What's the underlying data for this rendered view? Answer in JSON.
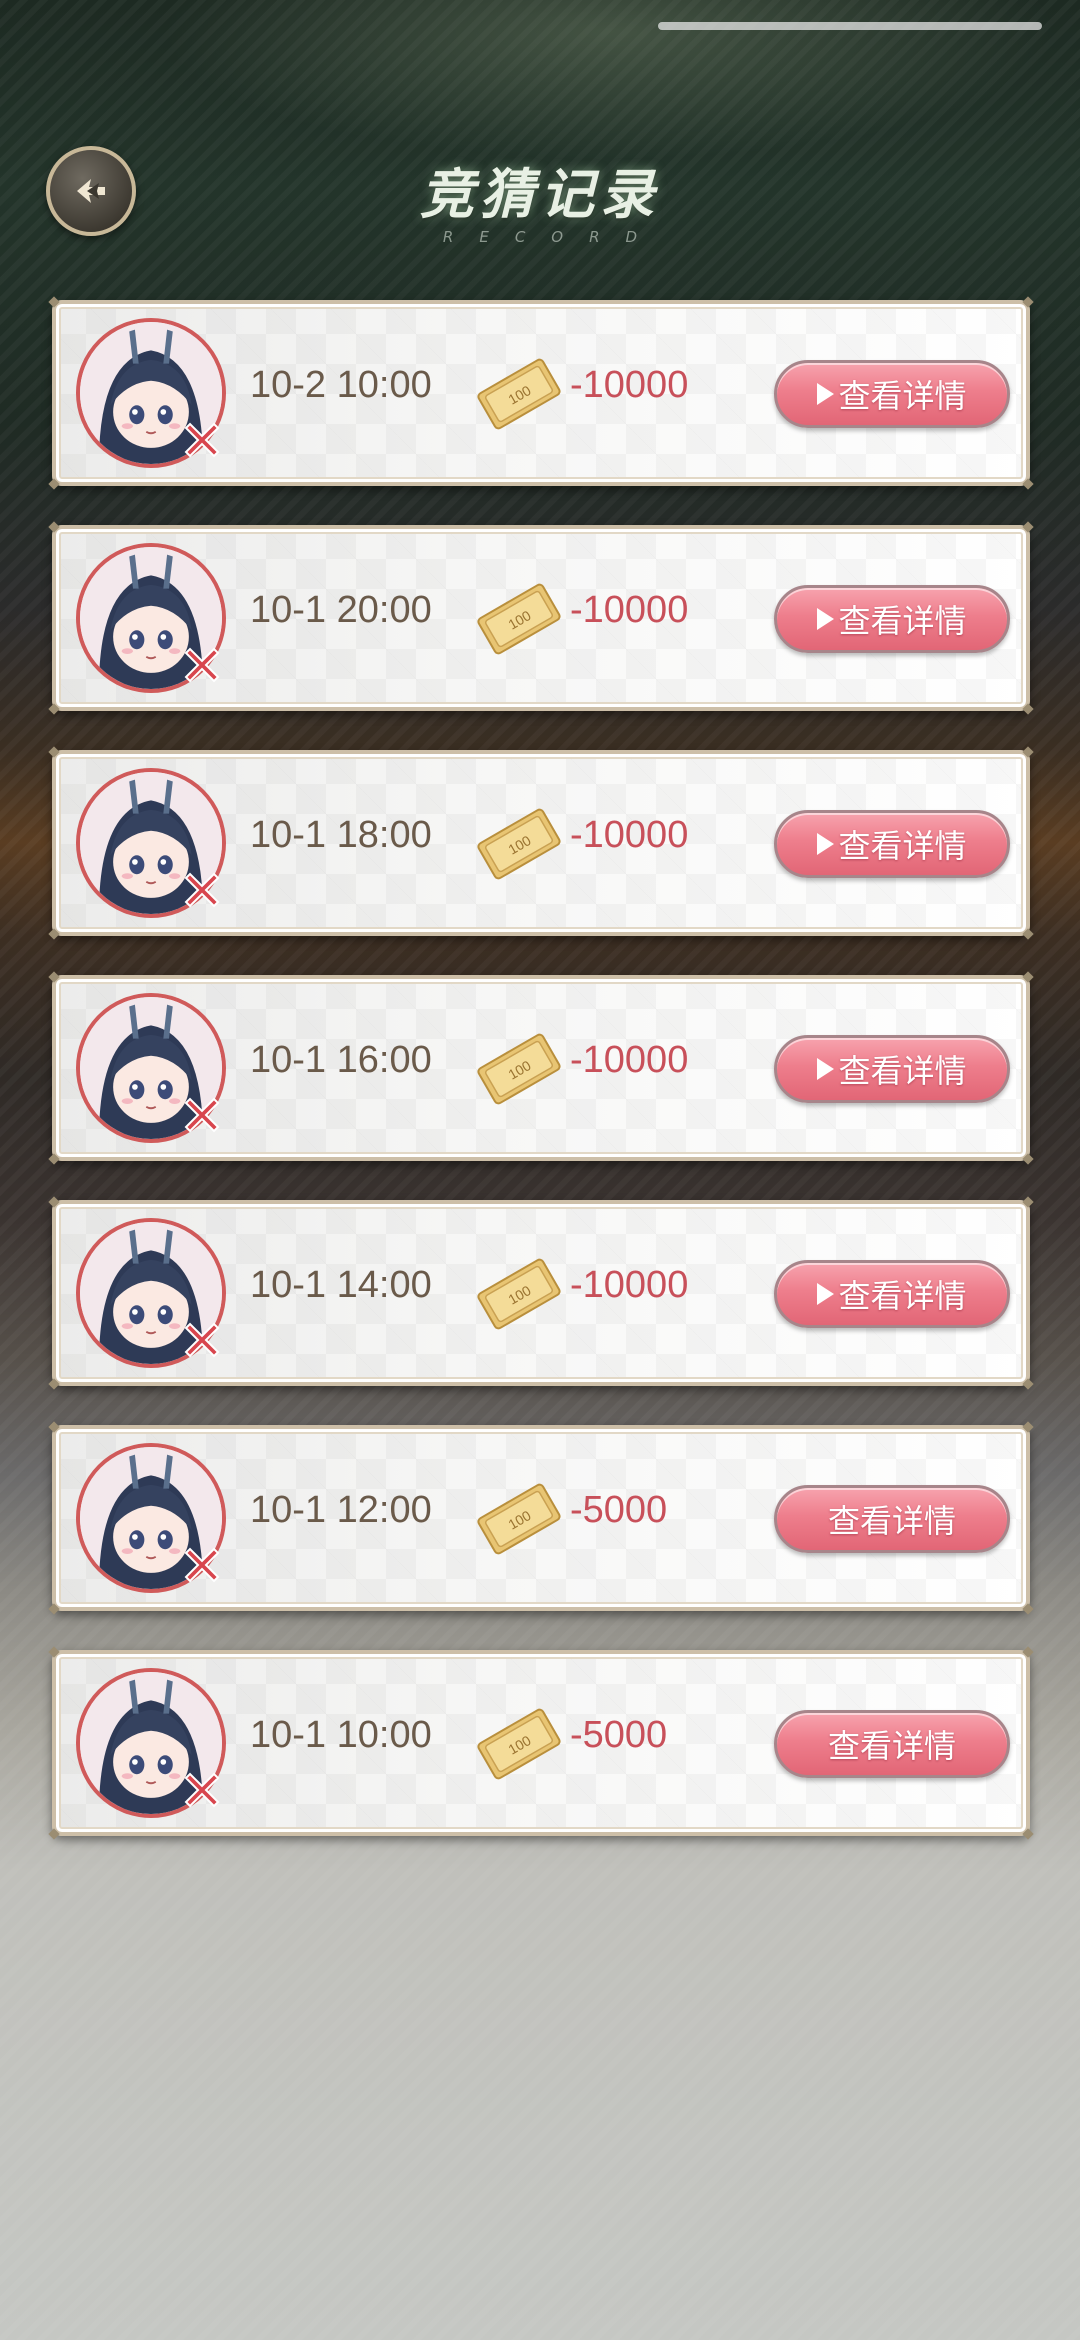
{
  "header": {
    "title": "竞猜记录",
    "subtitle": "RECORD"
  },
  "icons": {
    "back": "back-arrow-icon",
    "avatar": "chibi-character-avatar",
    "result": "red-x-icon",
    "currency": "ticket-100-icon",
    "button_prefix": "play-triangle-icon"
  },
  "colors": {
    "amount": "#c8505a",
    "button": "#ee7e8c",
    "avatar_ring": "#d05a5a",
    "card_border": "#cdbfa8"
  },
  "records": [
    {
      "time": "10-2 10:00",
      "amount": "-10000",
      "button_label": "查看详情",
      "show_play_icon": true
    },
    {
      "time": "10-1 20:00",
      "amount": "-10000",
      "button_label": "查看详情",
      "show_play_icon": true
    },
    {
      "time": "10-1 18:00",
      "amount": "-10000",
      "button_label": "查看详情",
      "show_play_icon": true
    },
    {
      "time": "10-1 16:00",
      "amount": "-10000",
      "button_label": "查看详情",
      "show_play_icon": true
    },
    {
      "time": "10-1 14:00",
      "amount": "-10000",
      "button_label": "查看详情",
      "show_play_icon": true
    },
    {
      "time": "10-1 12:00",
      "amount": "-5000",
      "button_label": "查看详情",
      "show_play_icon": false
    },
    {
      "time": "10-1 10:00",
      "amount": "-5000",
      "button_label": "查看详情",
      "show_play_icon": false
    }
  ]
}
